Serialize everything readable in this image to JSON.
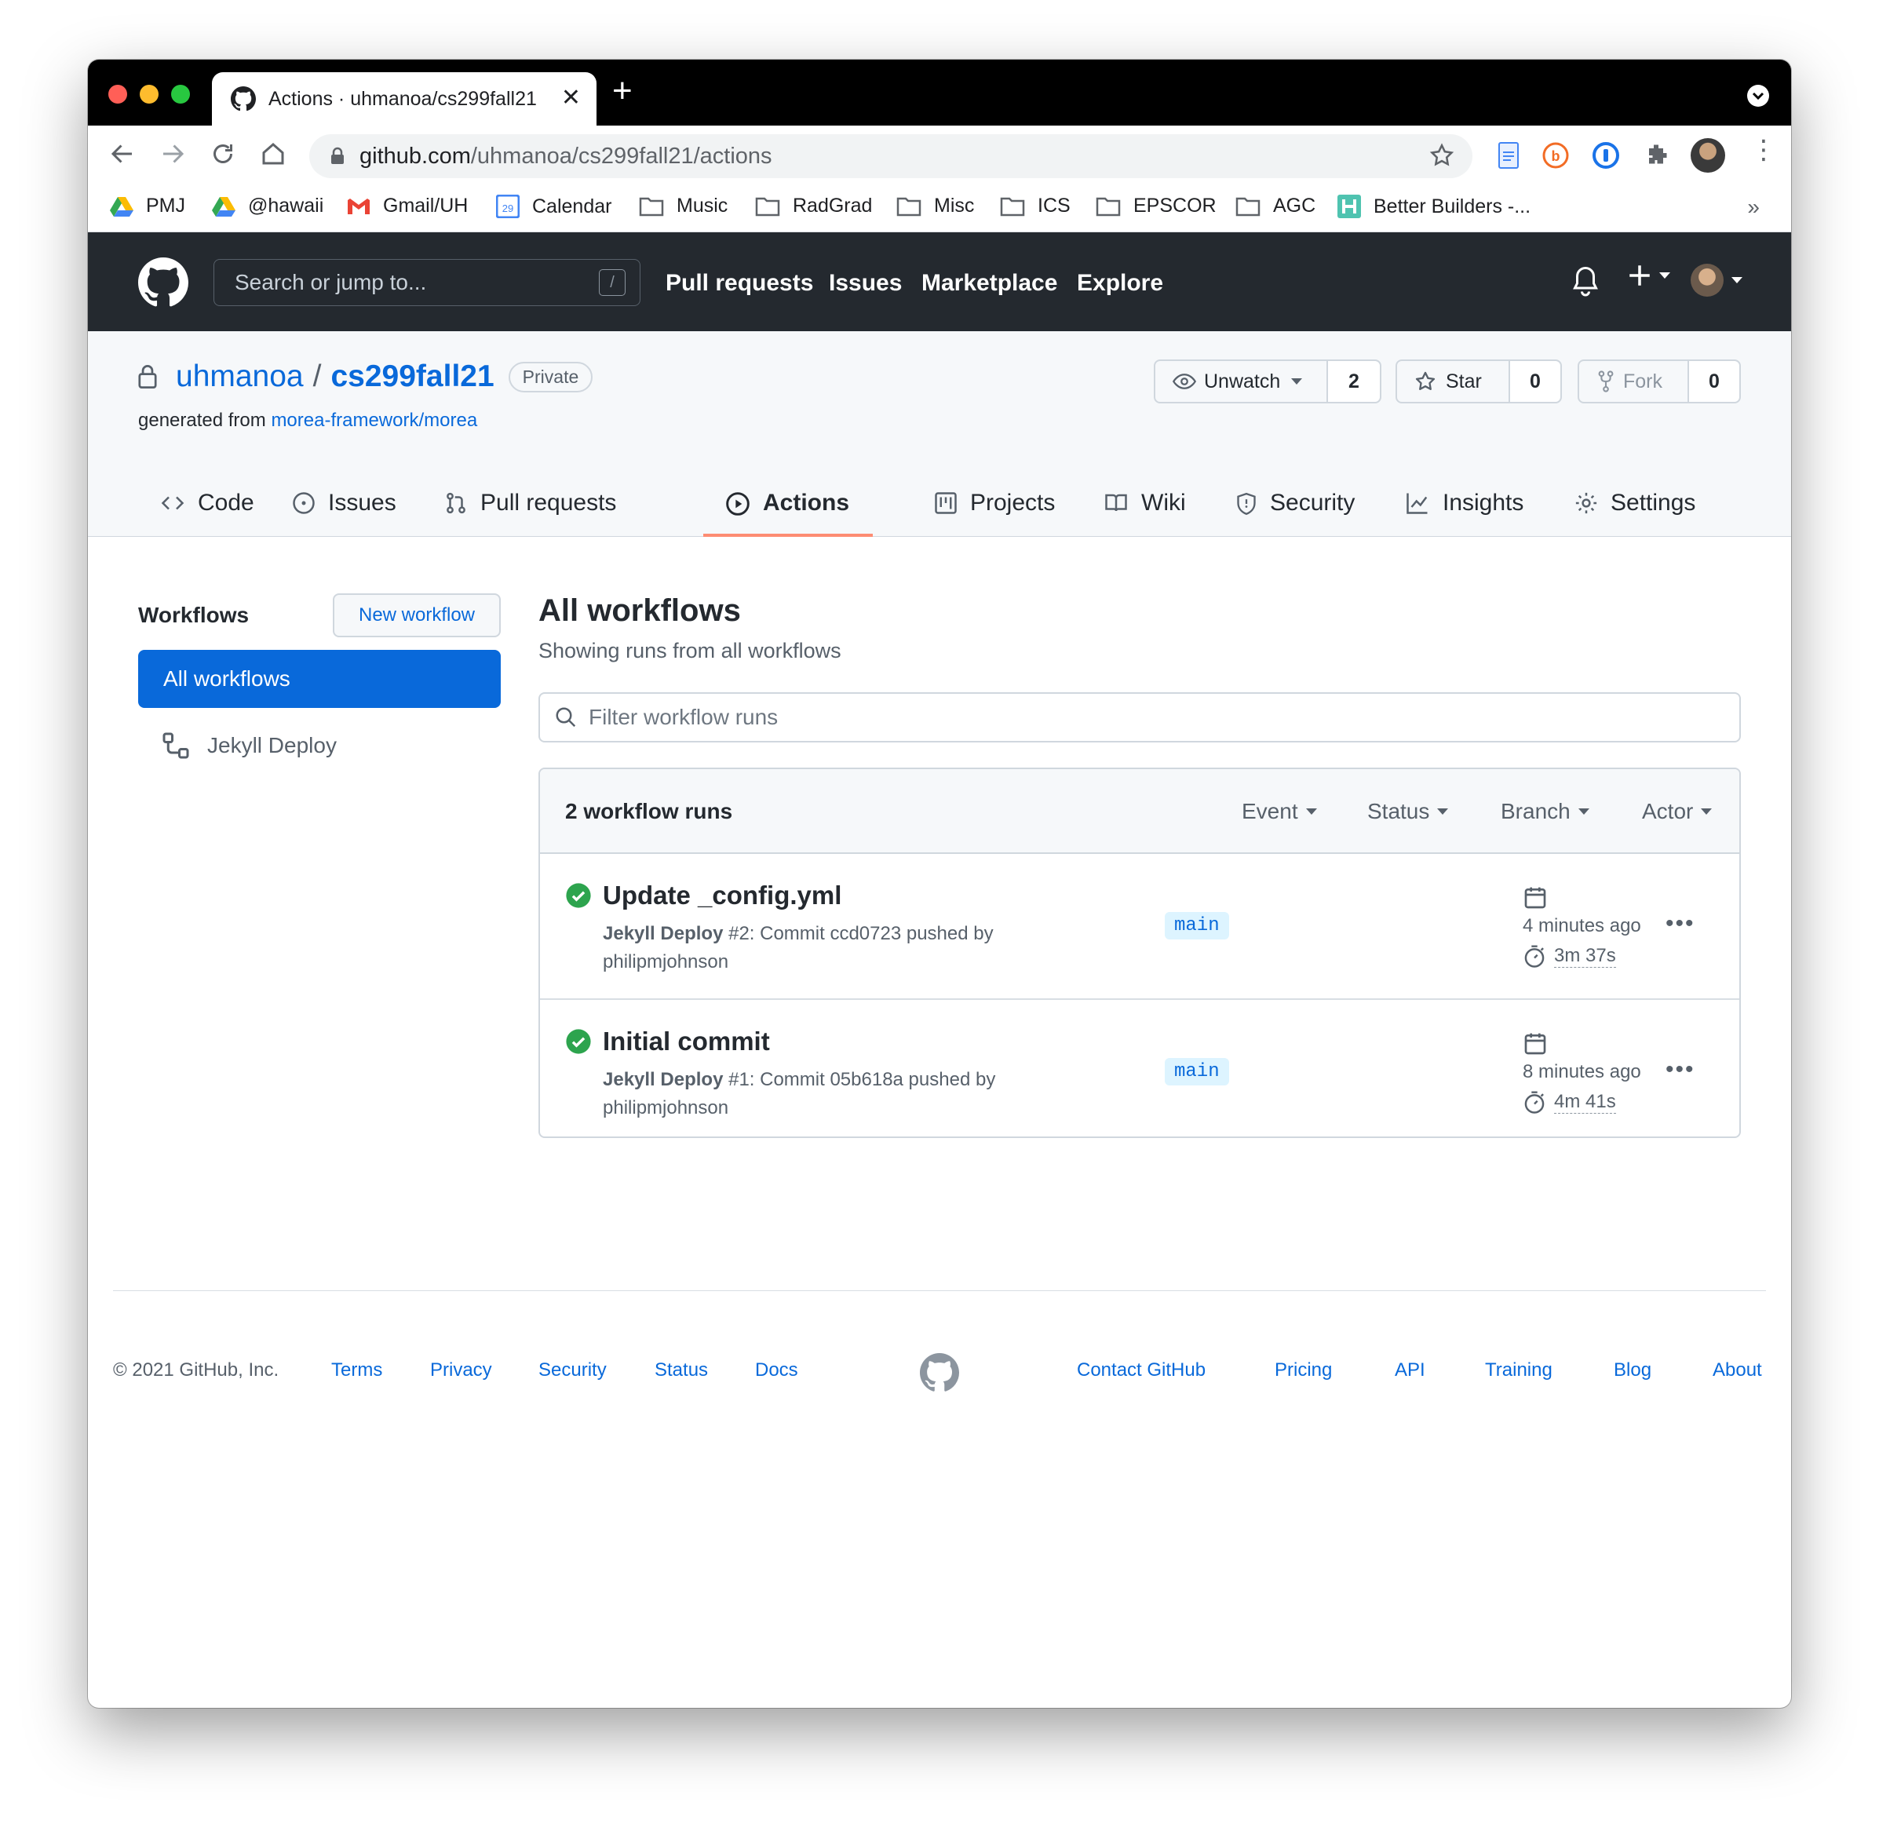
{
  "browser": {
    "tab_title": "Actions · uhmanoa/cs299fall21",
    "url_domain": "github.com",
    "url_path": "/uhmanoa/cs299fall21/actions",
    "bookmarks": [
      "PMJ",
      "@hawaii",
      "Gmail/UH",
      "Calendar",
      "Music",
      "RadGrad",
      "Misc",
      "ICS",
      "EPSCOR",
      "AGC",
      "Better Builders -..."
    ],
    "bookmarks_more": "»",
    "calendar_day": "29"
  },
  "gh": {
    "search_placeholder": "Search or jump to...",
    "search_key": "/",
    "nav": [
      "Pull requests",
      "Issues",
      "Marketplace",
      "Explore"
    ]
  },
  "repo": {
    "owner": "uhmanoa",
    "separator": "/",
    "name": "cs299fall21",
    "visibility": "Private",
    "generated_prefix": "generated from",
    "generated_link": "morea-framework/morea",
    "unwatch_label": "Unwatch",
    "watch_count": "2",
    "star_label": "Star",
    "star_count": "0",
    "fork_label": "Fork",
    "fork_count": "0",
    "tabs": [
      "Code",
      "Issues",
      "Pull requests",
      "Actions",
      "Projects",
      "Wiki",
      "Security",
      "Insights",
      "Settings"
    ],
    "active_tab": "Actions"
  },
  "sidebar": {
    "title": "Workflows",
    "new_workflow": "New workflow",
    "items": [
      "All workflows",
      "Jekyll Deploy"
    ]
  },
  "main": {
    "title": "All workflows",
    "subtitle": "Showing runs from all workflows",
    "filter_placeholder": "Filter workflow runs",
    "runs_count": "2 workflow runs",
    "filters": [
      "Event",
      "Status",
      "Branch",
      "Actor"
    ],
    "runs": [
      {
        "title": "Update _config.yml",
        "workflow": "Jekyll Deploy",
        "detail": "#2: Commit ccd0723 pushed by",
        "actor": "philipmjohnson",
        "branch": "main",
        "time": "4 minutes ago",
        "duration": "3m 37s",
        "status": "success"
      },
      {
        "title": "Initial commit",
        "workflow": "Jekyll Deploy",
        "detail": "#1: Commit 05b618a pushed by",
        "actor": "philipmjohnson",
        "branch": "main",
        "time": "8 minutes ago",
        "duration": "4m 41s",
        "status": "success"
      }
    ],
    "kebab": "•••"
  },
  "footer": {
    "copyright": "© 2021 GitHub, Inc.",
    "left_links": [
      "Terms",
      "Privacy",
      "Security",
      "Status",
      "Docs"
    ],
    "right_links": [
      "Contact GitHub",
      "Pricing",
      "API",
      "Training",
      "Blog",
      "About"
    ]
  },
  "colors": {
    "accent": "#0969da",
    "header_bg": "#24292f",
    "success": "#2da44e",
    "active_tab_underline": "#fd8c73"
  }
}
